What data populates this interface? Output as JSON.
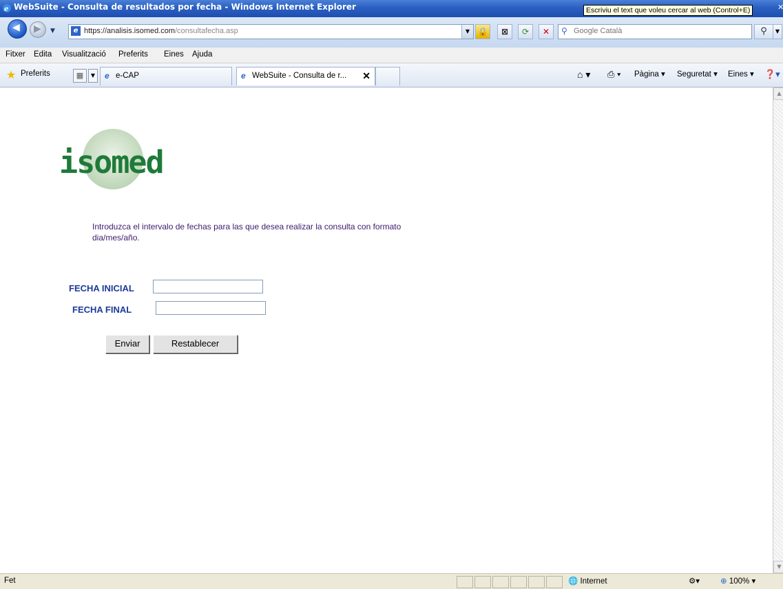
{
  "window": {
    "title": "WebSuite - Consulta de resultados por fecha - Windows Internet Explorer",
    "tooltip": "Escriviu el text que voleu cercar al web (Control+E)"
  },
  "navigation": {
    "url_host": "https://analisis.isomed.com",
    "url_path": "/consultafecha.asp",
    "search_placeholder": "Google Català"
  },
  "menu": {
    "items": [
      "Fitxer",
      "Edita",
      "Visualització",
      "Preferits",
      "Eines",
      "Ajuda"
    ]
  },
  "favorites": {
    "label": "Preferits",
    "link": "e-CAP"
  },
  "tabs": [
    {
      "label": "WebSuite - Consulta de r..."
    }
  ],
  "commands": {
    "page": "Pàgina ▾",
    "safety": "Seguretat ▾",
    "tools": "Eines ▾"
  },
  "page": {
    "logo_text": "isomed",
    "intro": "Introduzca el intervalo de fechas para las que desea realizar la consulta con formato dia/mes/año.",
    "fecha_inicial_label": "FECHA INICIAL",
    "fecha_final_label": "FECHA FINAL",
    "fecha_inicial_value": "",
    "fecha_final_value": "",
    "submit_label": "Enviar",
    "reset_label": "Restablecer"
  },
  "status": {
    "text": "Fet",
    "zone": "Internet",
    "zoom": "100%"
  },
  "colors": {
    "titlebar": "#2a5fc0",
    "logo_green": "#1f7a3a",
    "label_blue": "#1d3a9a",
    "intro_text": "#3b1a6b"
  }
}
